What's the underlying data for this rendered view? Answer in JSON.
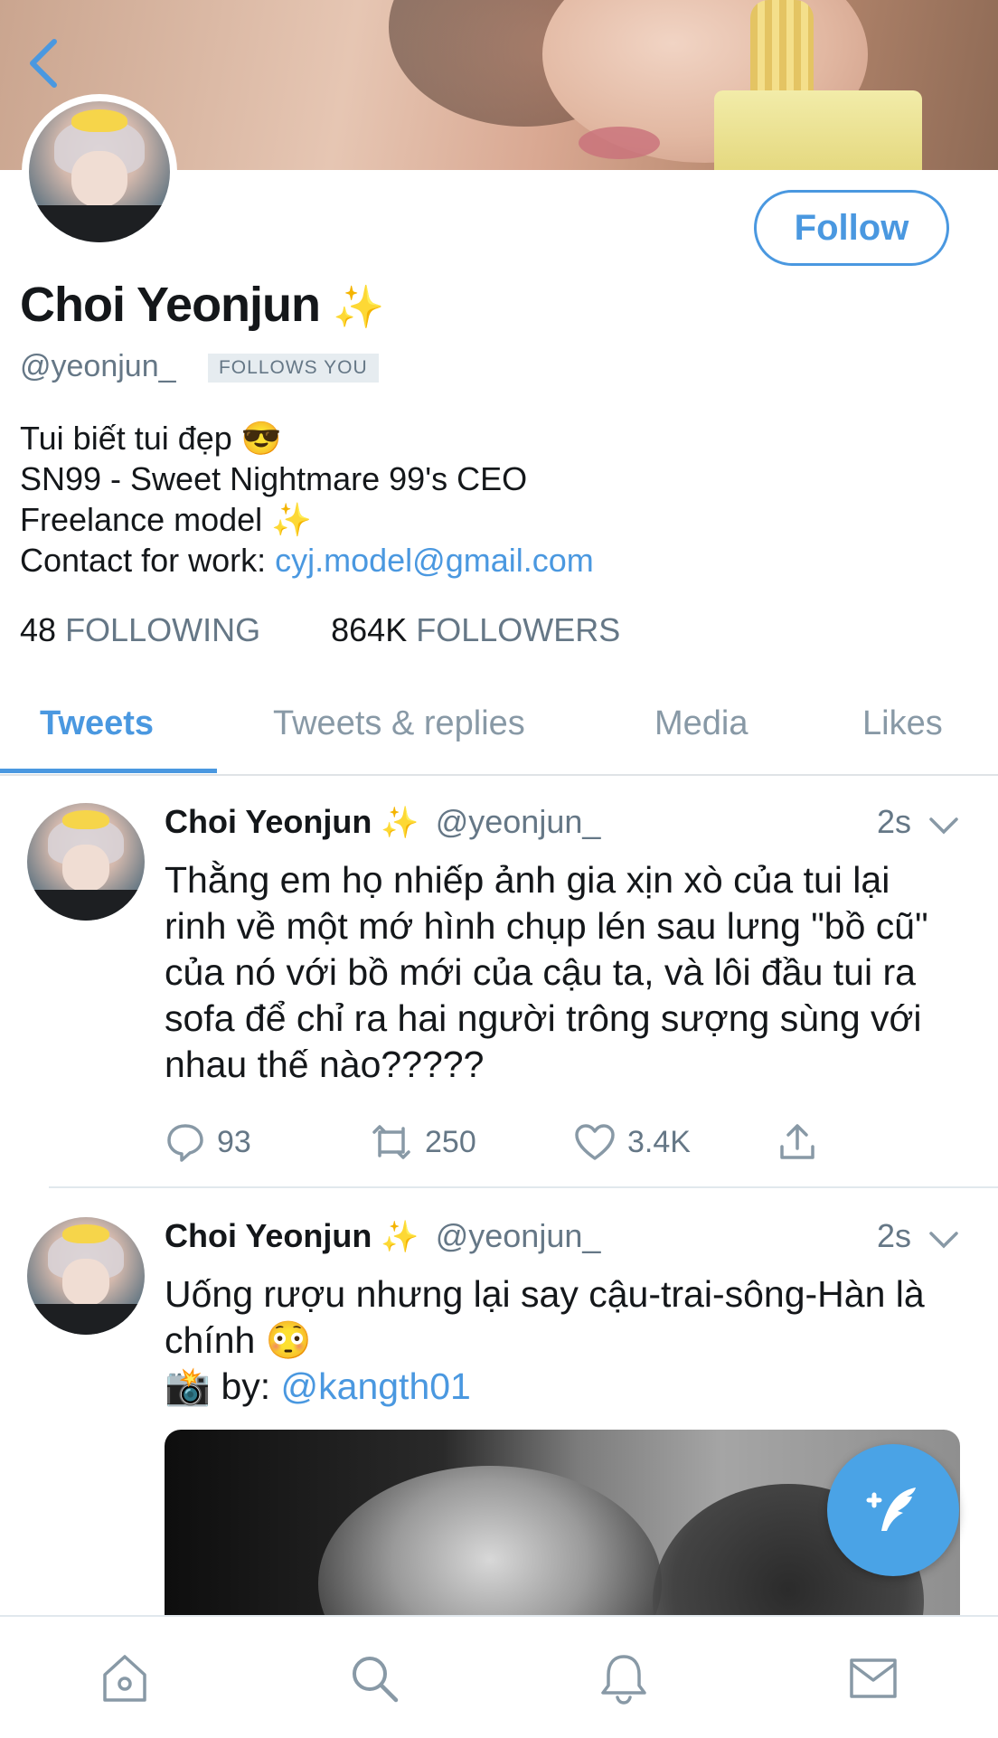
{
  "colors": {
    "accent": "#4a98e0",
    "muted": "#657786",
    "text": "#14171a"
  },
  "profile": {
    "name": "Choi Yeonjun",
    "name_emoji": "✨",
    "handle": "@yeonjun_",
    "follows_you": "FOLLOWS YOU",
    "follow_label": "Follow",
    "bio": {
      "line1": "Tui biết tui đẹp 😎",
      "line2": "SN99 - Sweet Nightmare 99's CEO",
      "line3": "Freelance model",
      "line3_emoji": "✨",
      "line4_prefix": "Contact for work: ",
      "line4_link": "cyj.model@gmail.com"
    },
    "stats": {
      "following_count": "48",
      "following_label": "FOLLOWING",
      "followers_count": "864K",
      "followers_label": "FOLLOWERS"
    }
  },
  "tabs": [
    {
      "label": "Tweets",
      "active": true
    },
    {
      "label": "Tweets & replies",
      "active": false
    },
    {
      "label": "Media",
      "active": false
    },
    {
      "label": "Likes",
      "active": false
    }
  ],
  "tweets": [
    {
      "name": "Choi Yeonjun",
      "emoji": "✨",
      "handle": "@yeonjun_",
      "time": "2s",
      "text": "Thằng em họ nhiếp ảnh gia xịn xò của tui lại rinh về một mớ hình chụp lén sau lưng \"bồ cũ\" của nó với bồ mới của cậu ta, và lôi đầu tui ra sofa để chỉ ra hai người trông sượng sùng với nhau thế nào?????",
      "replies": "93",
      "retweets": "250",
      "likes": "3.4K"
    },
    {
      "name": "Choi Yeonjun",
      "emoji": "✨",
      "handle": "@yeonjun_",
      "time": "2s",
      "text_line1": "Uống rượu nhưng lại say cậu-trai-sông-Hàn là chính 😳",
      "credit_prefix": "📸 by: ",
      "credit_link": "@kangth01"
    }
  ],
  "icons": {
    "back": "chevron-left-icon",
    "reply": "reply-icon",
    "retweet": "retweet-icon",
    "like": "heart-icon",
    "share": "share-icon",
    "compose": "compose-feather-icon",
    "nav": [
      "home-icon",
      "search-icon",
      "bell-icon",
      "mail-icon"
    ]
  }
}
